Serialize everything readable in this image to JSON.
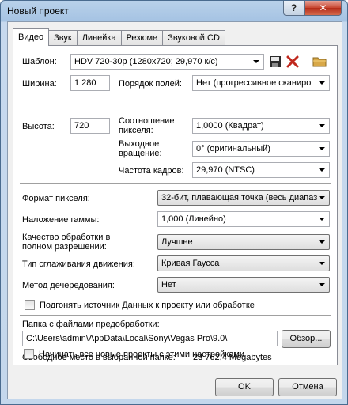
{
  "window": {
    "title": "Новый проект",
    "help": "?",
    "close": "✕"
  },
  "tabs": [
    "Видео",
    "Звук",
    "Линейка",
    "Резюме",
    "Звуковой CD"
  ],
  "template": {
    "label": "Шаблон:",
    "value": "HDV 720-30p (1280x720; 29,970 к/с)"
  },
  "width": {
    "label": "Ширина:",
    "value": "1 280"
  },
  "height": {
    "label": "Высота:",
    "value": "720"
  },
  "field_order": {
    "label": "Порядок полей:",
    "value": "Нет (прогрессивное сканиро"
  },
  "aspect": {
    "label1": "Соотношение",
    "label2": "пикселя:",
    "value": "1,0000 (Квадрат)"
  },
  "rotation": {
    "label1": "Выходное",
    "label2": "вращение:",
    "value": "0° (оригинальный)"
  },
  "frame_rate": {
    "label": "Частота кадров:",
    "value": "29,970 (NTSC)"
  },
  "pixel_format": {
    "label": "Формат пикселя:",
    "value": "32-бит, плавающая точка (весь диапаз"
  },
  "gamma": {
    "label": "Наложение гаммы:",
    "value": "1,000 (Линейно)"
  },
  "quality": {
    "label1": "Качество обработки в",
    "label2": "полном разрешении:",
    "value": "Лучшее"
  },
  "motion_blur": {
    "label": "Тип сглаживания движения:",
    "value": "Кривая Гаусса"
  },
  "deinterlace": {
    "label": "Метод дечередования:",
    "value": "Нет"
  },
  "adjust_source": {
    "label": "Подгонять источник Данных к проекту или обработке",
    "checked": false
  },
  "prerender": {
    "label": "Папка с файлами предобработки:",
    "path": "C:\\Users\\admin\\AppData\\Local\\Sony\\Vegas Pro\\9.0\\",
    "browse": "Обзор..."
  },
  "free_space": {
    "label": "Свободное место в выбранной папке:",
    "value": "23 762,4 Megabytes"
  },
  "start_all": {
    "label": "Начинать все новые проекты с этими настройками",
    "checked": false
  },
  "buttons": {
    "ok": "OK",
    "cancel": "Отмена"
  },
  "icons": {
    "save": "floppy-disk-icon",
    "delete": "red-x-icon",
    "folder": "folder-icon"
  }
}
